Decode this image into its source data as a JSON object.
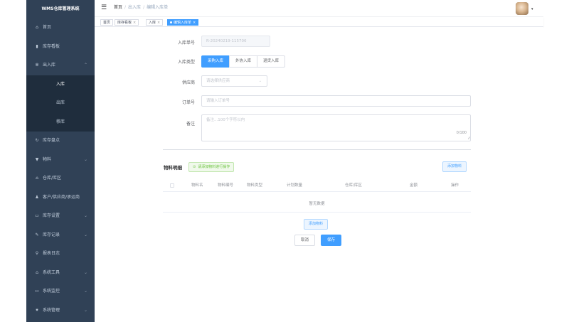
{
  "sidebar": {
    "title": "WMS仓库管理系统",
    "items": [
      {
        "icon": "home-icon",
        "glyph": "⌂",
        "label": "首页",
        "chevron": ""
      },
      {
        "icon": "bar-chart-icon",
        "glyph": "▮",
        "label": "库存看板",
        "chevron": ""
      },
      {
        "icon": "snowflake-icon",
        "glyph": "✻",
        "label": "出入库",
        "chevron": "⌃"
      },
      {
        "icon": "",
        "glyph": "",
        "label": "入库",
        "chevron": ""
      },
      {
        "icon": "",
        "glyph": "",
        "label": "出库",
        "chevron": ""
      },
      {
        "icon": "",
        "glyph": "",
        "label": "移库",
        "chevron": ""
      },
      {
        "icon": "sync-icon",
        "glyph": "↻",
        "label": "库存盘点",
        "chevron": ""
      },
      {
        "icon": "cart-icon",
        "glyph": "▼",
        "label": "物料",
        "chevron": "⌄"
      },
      {
        "icon": "warehouse-icon",
        "glyph": "⌂",
        "label": "仓库/库区",
        "chevron": ""
      },
      {
        "icon": "user-icon",
        "glyph": "♟",
        "label": "客户/供应商/承运商",
        "chevron": ""
      },
      {
        "icon": "monitor-icon",
        "glyph": "▭",
        "label": "库存设置",
        "chevron": "⌄"
      },
      {
        "icon": "pen-icon",
        "glyph": "✎",
        "label": "库存记录",
        "chevron": "⌄"
      },
      {
        "icon": "log-icon",
        "glyph": "⚲",
        "label": "报表日志",
        "chevron": ""
      },
      {
        "icon": "toolbox-icon",
        "glyph": "⌂",
        "label": "系统工具",
        "chevron": "⌄"
      },
      {
        "icon": "monitor-icon",
        "glyph": "▭",
        "label": "系统监控",
        "chevron": "⌄"
      },
      {
        "icon": "gear-icon",
        "glyph": "✷",
        "label": "系统管理",
        "chevron": "⌄"
      }
    ]
  },
  "navbar": {
    "hamburger_glyph": "☰",
    "breadcrumb": [
      "首页",
      "出入库",
      "编辑入库单"
    ],
    "avatar_caret": "▾"
  },
  "tags": [
    {
      "label": "首页",
      "close": ""
    },
    {
      "label": "库存看板",
      "close": "×"
    },
    {
      "label": "入库",
      "close": "×"
    },
    {
      "label": "编辑入库单",
      "close": "×"
    }
  ],
  "form": {
    "order_no": {
      "label": "入库单号",
      "value": "R-20240219-115706"
    },
    "type": {
      "label": "入库类型",
      "options": [
        "采购入库",
        "外协入库",
        "退货入库"
      ],
      "selected": 0
    },
    "supplier": {
      "label": "供应商",
      "placeholder": "请选择供应商",
      "chevron": "⌄"
    },
    "order_num": {
      "label": "订单号",
      "placeholder": "请输入订单号"
    },
    "remark": {
      "label": "备注",
      "placeholder": "备注...100个字符以内",
      "count": "0/100",
      "grip": "⁄⁄"
    }
  },
  "materials": {
    "title": "物料明细",
    "tip_icon": "⊙",
    "tip": "请添加物料进行操作",
    "add_top": "添加物料",
    "columns": [
      "物料名",
      "物料编号",
      "物料类型",
      "计划数量",
      "仓库/库区",
      "金额",
      "操作"
    ],
    "empty": "暂无数据",
    "add_bottom": "添加物料"
  },
  "actions": {
    "cancel": "取消",
    "save": "保存"
  },
  "colors": {
    "sidebar_bg": "#304156",
    "accent": "#409eff",
    "success": "#67c23a"
  }
}
